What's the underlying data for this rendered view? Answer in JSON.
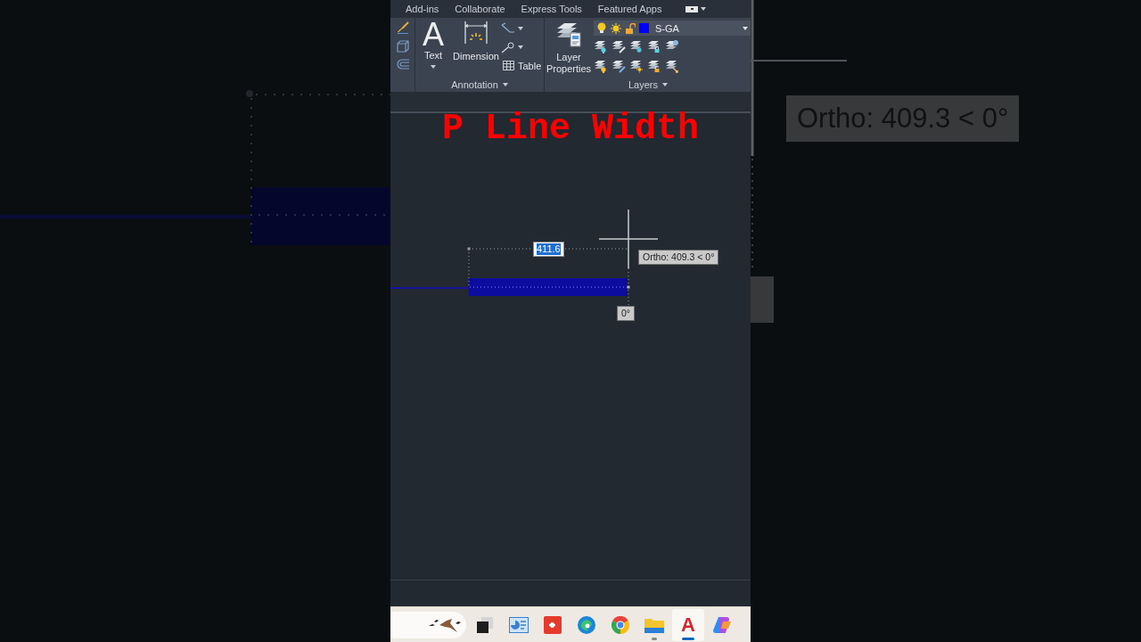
{
  "ribbon_tabs": [
    {
      "label": "Add-ins",
      "selected": false
    },
    {
      "label": "Collaborate",
      "selected": false
    },
    {
      "label": "Express Tools",
      "selected": false
    },
    {
      "label": "Featured Apps",
      "selected": false
    }
  ],
  "ribbon": {
    "annotation": {
      "title": "Annotation",
      "text_tool": {
        "glyph": "A",
        "label": "Text"
      },
      "dimension_tool": {
        "label": "Dimension"
      },
      "table_tool": {
        "label": "Table"
      }
    },
    "layers": {
      "title": "Layers",
      "layer_properties": {
        "label": "Layer Properties"
      },
      "current_layer": {
        "name": "S-GA",
        "color": "#0000ff",
        "on": true,
        "frozen": false,
        "locked": false
      }
    }
  },
  "drawing": {
    "title": "P Line Width",
    "dynamic_input": {
      "value": "411.6",
      "highlighted": true
    },
    "ortho_tooltip": "Ortho: 409.3 < 0°",
    "angle_tooltip": "0°"
  },
  "background": {
    "ortho_tooltip": "Ortho: 409.3 < 0°"
  },
  "taskbar": {
    "apps": [
      {
        "kind": "task_view",
        "selected": false,
        "running": false
      },
      {
        "kind": "dashboard",
        "selected": false,
        "running": false
      },
      {
        "kind": "remote",
        "selected": false,
        "running": false
      },
      {
        "kind": "edge",
        "selected": false,
        "running": false
      },
      {
        "kind": "chrome",
        "selected": false,
        "running": false
      },
      {
        "kind": "files",
        "selected": false,
        "running": true
      },
      {
        "kind": "cad",
        "glyph": "A",
        "selected": true,
        "running": true
      },
      {
        "kind": "copilot",
        "selected": false,
        "running": false
      }
    ]
  }
}
